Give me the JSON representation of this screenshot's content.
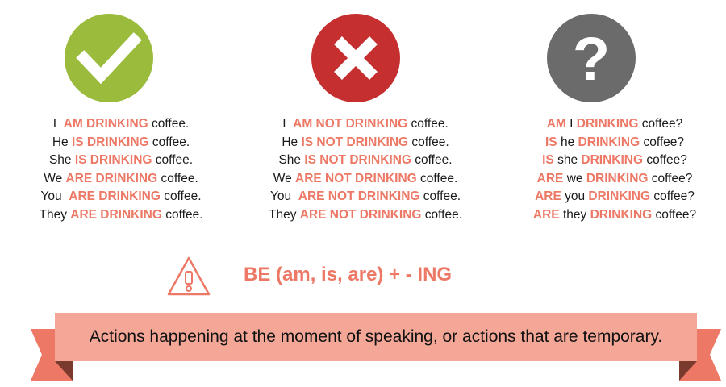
{
  "icons": {
    "affirmative": "check-icon",
    "negative": "cross-icon",
    "question": "question-icon",
    "warning": "warning-icon"
  },
  "colors": {
    "check": "#9bbb3c",
    "cross": "#c62f2f",
    "question": "#6b6b6b",
    "highlight": "#ec7865",
    "ribbon": "#f4a797",
    "ribbon_tail": "#ec7865"
  },
  "affirmative": {
    "lines": [
      [
        {
          "t": "I  "
        },
        {
          "t": "AM DRINKING",
          "h": true
        },
        {
          "t": " coffee."
        }
      ],
      [
        {
          "t": "He "
        },
        {
          "t": "IS DRINKING",
          "h": true
        },
        {
          "t": " coffee."
        }
      ],
      [
        {
          "t": "She "
        },
        {
          "t": "IS DRINKING",
          "h": true
        },
        {
          "t": " coffee."
        }
      ],
      [
        {
          "t": "We "
        },
        {
          "t": "ARE DRINKING",
          "h": true
        },
        {
          "t": " coffee."
        }
      ],
      [
        {
          "t": "You  "
        },
        {
          "t": "ARE DRINKING",
          "h": true
        },
        {
          "t": " coffee."
        }
      ],
      [
        {
          "t": "They "
        },
        {
          "t": "ARE DRINKING",
          "h": true
        },
        {
          "t": " coffee."
        }
      ]
    ]
  },
  "negative": {
    "lines": [
      [
        {
          "t": "I  "
        },
        {
          "t": "AM NOT DRINKING",
          "h": true
        },
        {
          "t": " coffee."
        }
      ],
      [
        {
          "t": "He "
        },
        {
          "t": "IS NOT DRINKING",
          "h": true
        },
        {
          "t": " coffee."
        }
      ],
      [
        {
          "t": "She "
        },
        {
          "t": "IS NOT DRINKING",
          "h": true
        },
        {
          "t": " coffee."
        }
      ],
      [
        {
          "t": "We "
        },
        {
          "t": "ARE NOT DRINKING",
          "h": true
        },
        {
          "t": " coffee."
        }
      ],
      [
        {
          "t": "You  "
        },
        {
          "t": "ARE NOT DRINKING",
          "h": true
        },
        {
          "t": " coffee."
        }
      ],
      [
        {
          "t": "They "
        },
        {
          "t": "ARE NOT DRINKING",
          "h": true
        },
        {
          "t": " coffee."
        }
      ]
    ]
  },
  "question": {
    "lines": [
      [
        {
          "t": "AM",
          "h": true
        },
        {
          "t": " I "
        },
        {
          "t": "DRINKING",
          "h": true
        },
        {
          "t": " coffee?"
        }
      ],
      [
        {
          "t": "IS",
          "h": true
        },
        {
          "t": " he "
        },
        {
          "t": "DRINKING",
          "h": true
        },
        {
          "t": " coffee?"
        }
      ],
      [
        {
          "t": "IS",
          "h": true
        },
        {
          "t": " she "
        },
        {
          "t": "DRINKING",
          "h": true
        },
        {
          "t": " coffee?"
        }
      ],
      [
        {
          "t": "ARE",
          "h": true
        },
        {
          "t": " we "
        },
        {
          "t": "DRINKING",
          "h": true
        },
        {
          "t": " coffee?"
        }
      ],
      [
        {
          "t": "ARE",
          "h": true
        },
        {
          "t": " you "
        },
        {
          "t": "DRINKING",
          "h": true
        },
        {
          "t": " coffee?"
        }
      ],
      [
        {
          "t": "ARE",
          "h": true
        },
        {
          "t": " they "
        },
        {
          "t": "DRINKING",
          "h": true
        },
        {
          "t": " coffee?"
        }
      ]
    ]
  },
  "formula": "BE (am, is, are) + - ING",
  "definition": "Actions happening at the moment of speaking, or actions that are temporary."
}
